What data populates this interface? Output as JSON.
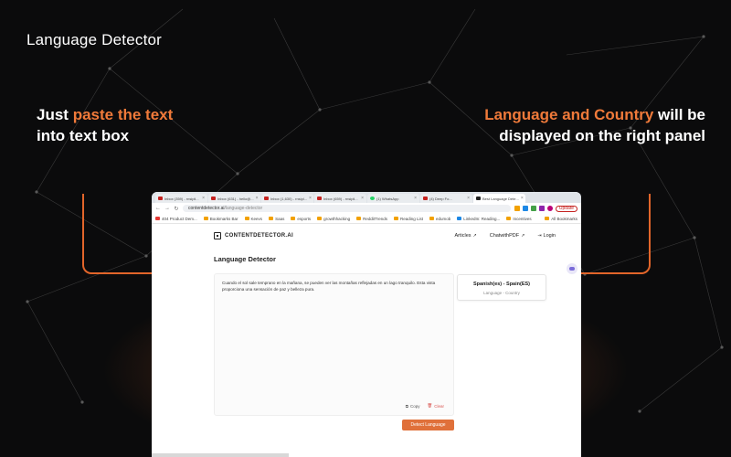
{
  "slide": {
    "title": "Language Detector",
    "left_caption": {
      "pre": "Just ",
      "highlight": "paste the text",
      "post": " into text box"
    },
    "right_caption": {
      "highlight": "Language and Country",
      "post": " will be displayed on the right panel"
    },
    "accent_color": "#f07a3a"
  },
  "browser": {
    "tabs": [
      {
        "label": "Inbox (359) - rnsipli...",
        "icon": "gmail-icon"
      },
      {
        "label": "Inbox (631) - hello@...",
        "icon": "gmail-icon"
      },
      {
        "label": "Inbox (1,630) - rnsipl...",
        "icon": "gmail-icon"
      },
      {
        "label": "Inbox (659) - rnsipli...",
        "icon": "gmail-icon"
      },
      {
        "label": "(1) WhatsApp",
        "icon": "whatsapp-icon"
      },
      {
        "label": "(4) Deep Fo...",
        "icon": "youtube-icon"
      },
      {
        "label": "Best Language Dete...",
        "icon": "site-icon",
        "active": true
      }
    ],
    "url": {
      "host": "contentdetector.ai",
      "path": "/language-detector"
    },
    "update_label": "Update",
    "bookmarks": [
      {
        "label": "404 Product Dem...",
        "icon": "youtube-icon"
      },
      {
        "label": "Bookmarks Bar",
        "icon": "folder-icon"
      },
      {
        "label": "Keevs",
        "icon": "folder-icon"
      },
      {
        "label": "Saas",
        "icon": "folder-icon"
      },
      {
        "label": "esports",
        "icon": "folder-icon"
      },
      {
        "label": "growthhacking",
        "icon": "folder-icon"
      },
      {
        "label": "RedditTrends",
        "icon": "folder-icon"
      },
      {
        "label": "Reading List",
        "icon": "folder-icon"
      },
      {
        "label": "edumob",
        "icon": "folder-icon"
      },
      {
        "label": "LinkedIn: Reading...",
        "icon": "linkedin-icon"
      },
      {
        "label": "Incentives",
        "icon": "folder-icon"
      }
    ],
    "all_bookmarks": "All Bookmarks"
  },
  "site": {
    "logo_text": "CONTENTDETECTOR.AI",
    "nav": {
      "articles": "Articles",
      "chat": "ChatwithPDF",
      "login": "Login"
    },
    "page_title": "Language Detector",
    "input_text": "Cuando el sol sale temprano en la mañana, se pueden ver las montañas reflejadas en un lago tranquilo. Esta vista proporciona una sensación de paz y belleza pura.",
    "copy_label": "Copy",
    "clear_label": "Clear",
    "detect_label": "Detect Language",
    "result": {
      "value": "Spanish(es) - Spain(ES)",
      "label": "Language - Country"
    }
  }
}
